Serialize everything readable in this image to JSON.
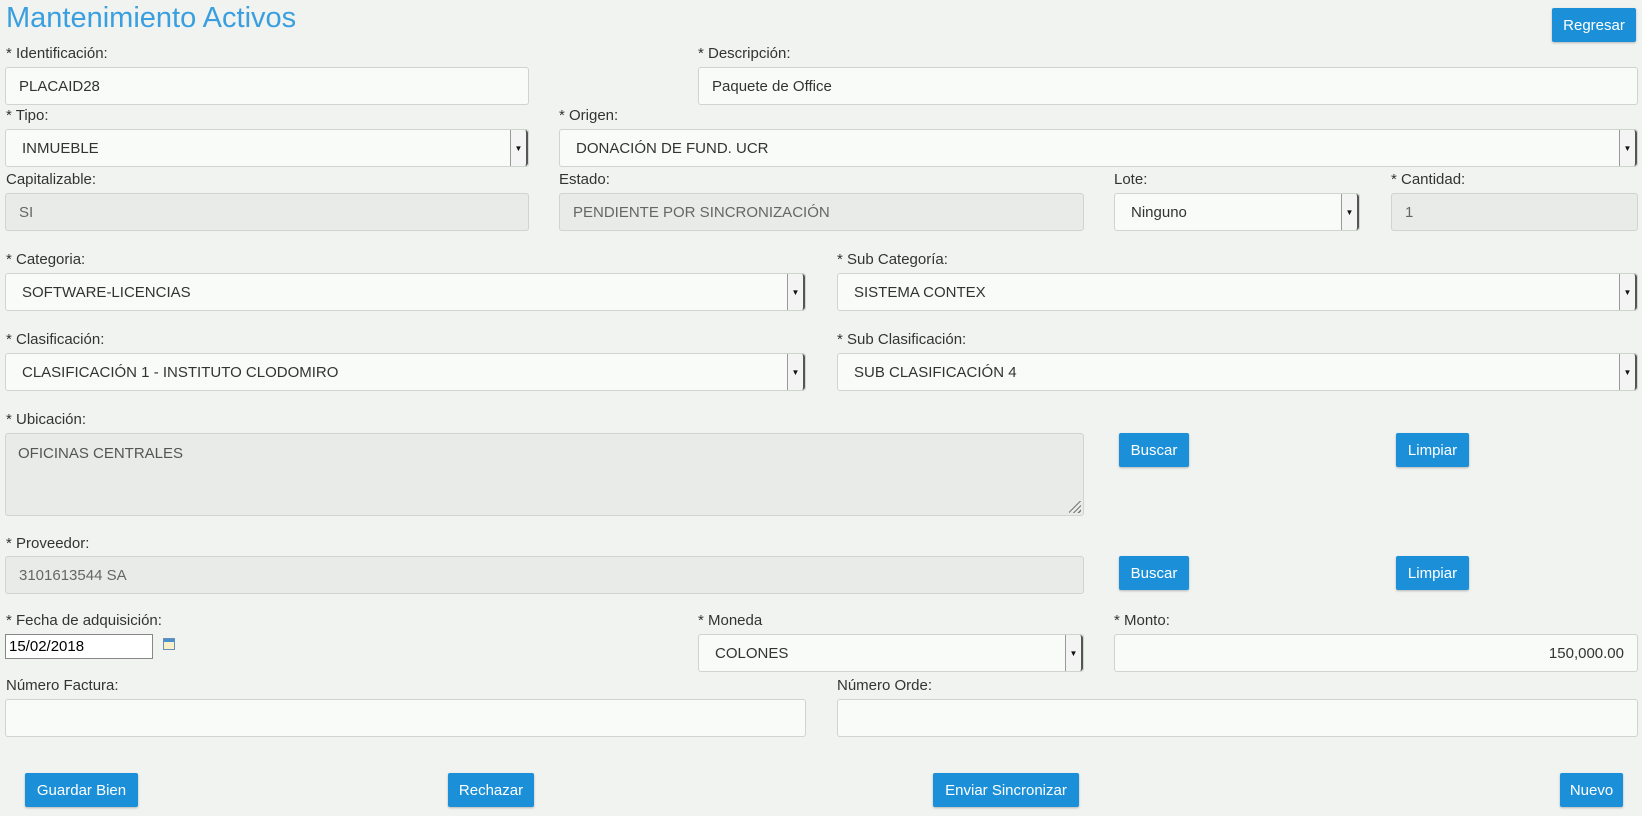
{
  "page": {
    "title": "Mantenimiento Activos"
  },
  "header": {
    "back_button": "Regresar"
  },
  "form": {
    "identificacion": {
      "label": "* Identificación:",
      "value": "PLACAID28"
    },
    "descripcion": {
      "label": "* Descripción:",
      "value": "Paquete de Office"
    },
    "tipo": {
      "label": "* Tipo:",
      "value": "INMUEBLE"
    },
    "origen": {
      "label": "* Origen:",
      "value": "DONACIÓN DE FUND. UCR"
    },
    "capitalizable": {
      "label": "Capitalizable:",
      "value": "SI"
    },
    "estado": {
      "label": "Estado:",
      "value": "PENDIENTE POR SINCRONIZACIÓN"
    },
    "lote": {
      "label": "Lote:",
      "value": "Ninguno"
    },
    "cantidad": {
      "label": "* Cantidad:",
      "value": "1"
    },
    "categoria": {
      "label": "* Categoria:",
      "value": "SOFTWARE-LICENCIAS"
    },
    "sub_categoria": {
      "label": "* Sub Categoría:",
      "value": "SISTEMA CONTEX"
    },
    "clasificacion": {
      "label": "* Clasificación:",
      "value": "CLASIFICACIÓN 1 - INSTITUTO CLODOMIRO"
    },
    "sub_clasificacion": {
      "label": "* Sub Clasificación:",
      "value": "SUB CLASIFICACIÓN 4"
    },
    "ubicacion": {
      "label": "* Ubicación:",
      "value": "OFICINAS CENTRALES",
      "search_button": "Buscar",
      "clear_button": "Limpiar"
    },
    "proveedor": {
      "label": "* Proveedor:",
      "value": "3101613544 SA",
      "search_button": "Buscar",
      "clear_button": "Limpiar"
    },
    "fecha_adquisicion": {
      "label": "* Fecha de adquisición:",
      "value": "15/02/2018"
    },
    "moneda": {
      "label": "* Moneda",
      "value": "COLONES"
    },
    "monto": {
      "label": "* Monto:",
      "value": "150,000.00"
    },
    "numero_factura": {
      "label": "Número Factura:",
      "value": ""
    },
    "numero_orden": {
      "label": "Número Orde:",
      "value": ""
    }
  },
  "actions": {
    "save": "Guardar Bien",
    "reject": "Rechazar",
    "sync": "Enviar Sincronizar",
    "new": "Nuevo"
  },
  "colors": {
    "accent": "#1b8fd8",
    "title": "#3a9fdf",
    "background": "#f1f3f1"
  }
}
